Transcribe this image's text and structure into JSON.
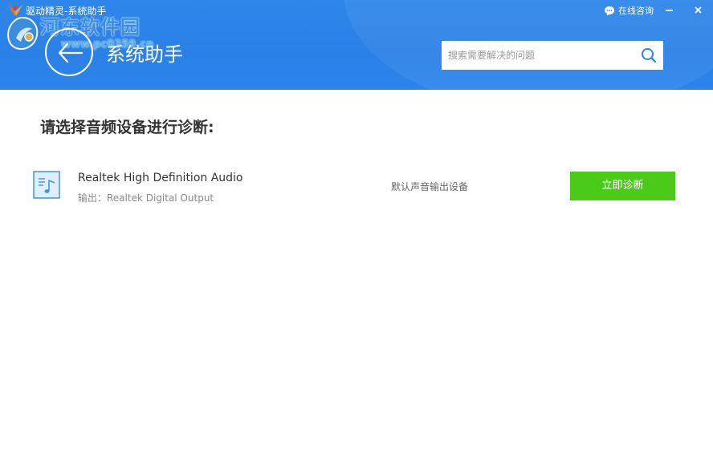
{
  "window": {
    "app_title": "驱动精灵-系统助手",
    "consult_label": "在线咨询",
    "minimize_label": "−",
    "close_label": "x"
  },
  "watermark": {
    "text": "河东软件园",
    "url": "www.pc0359.cn"
  },
  "header": {
    "page_title": "系统助手",
    "search": {
      "placeholder": "搜索需要解决的问题",
      "value": ""
    }
  },
  "main": {
    "prompt": "请选择音频设备进行诊断:",
    "devices": [
      {
        "name": "Realtek High Definition Audio",
        "output": "输出：Realtek Digital Output",
        "status": "默认声音输出设备",
        "action_label": "立即诊断",
        "icon": "music-file-icon"
      }
    ]
  },
  "colors": {
    "header_blue": "#2c83e8",
    "action_green": "#4cca1a",
    "text_dark": "#333333",
    "text_muted": "#888888"
  }
}
